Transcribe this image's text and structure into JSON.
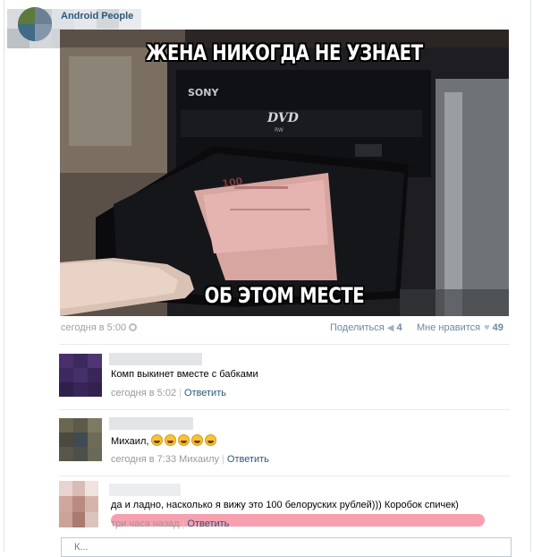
{
  "post": {
    "author": "Android People",
    "image": {
      "caption_top": "ЖЕНА НИКОГДА НЕ УЗНАЕТ",
      "caption_bottom": "ОБ ЭТОМ МЕСТЕ",
      "device_brand": "SONY",
      "device_logo": "DVD",
      "device_sub": "RW",
      "banknote_label": "100"
    },
    "date": "сегодня в 5:00",
    "share_label": "Поделиться",
    "share_count": "4",
    "like_label": "Мне нравится",
    "like_count": "49"
  },
  "comments": [
    {
      "text": "Комп выкинет вместе с бабками",
      "time": "сегодня в 5:02",
      "reply_to": "",
      "action": "Ответить"
    },
    {
      "text": "Михаил,",
      "emoji": [
        "rofl-emoji",
        "rofl-emoji",
        "rofl-emoji",
        "rofl-emoji",
        "rofl-emoji"
      ],
      "time": "сегодня в 7:33",
      "reply_to": "Михаилу",
      "action": "Ответить"
    },
    {
      "text": "да и ладно, насколько я вижу это 100 белоруских рублей))) Коробок спичек)",
      "time": "три часа назад",
      "reply_to": "",
      "action": "Ответить"
    }
  ],
  "reply_box": {
    "placeholder": "К..."
  },
  "colors": {
    "link": "#2b587a",
    "muted": "#999999",
    "highlight": "#f1526e"
  }
}
